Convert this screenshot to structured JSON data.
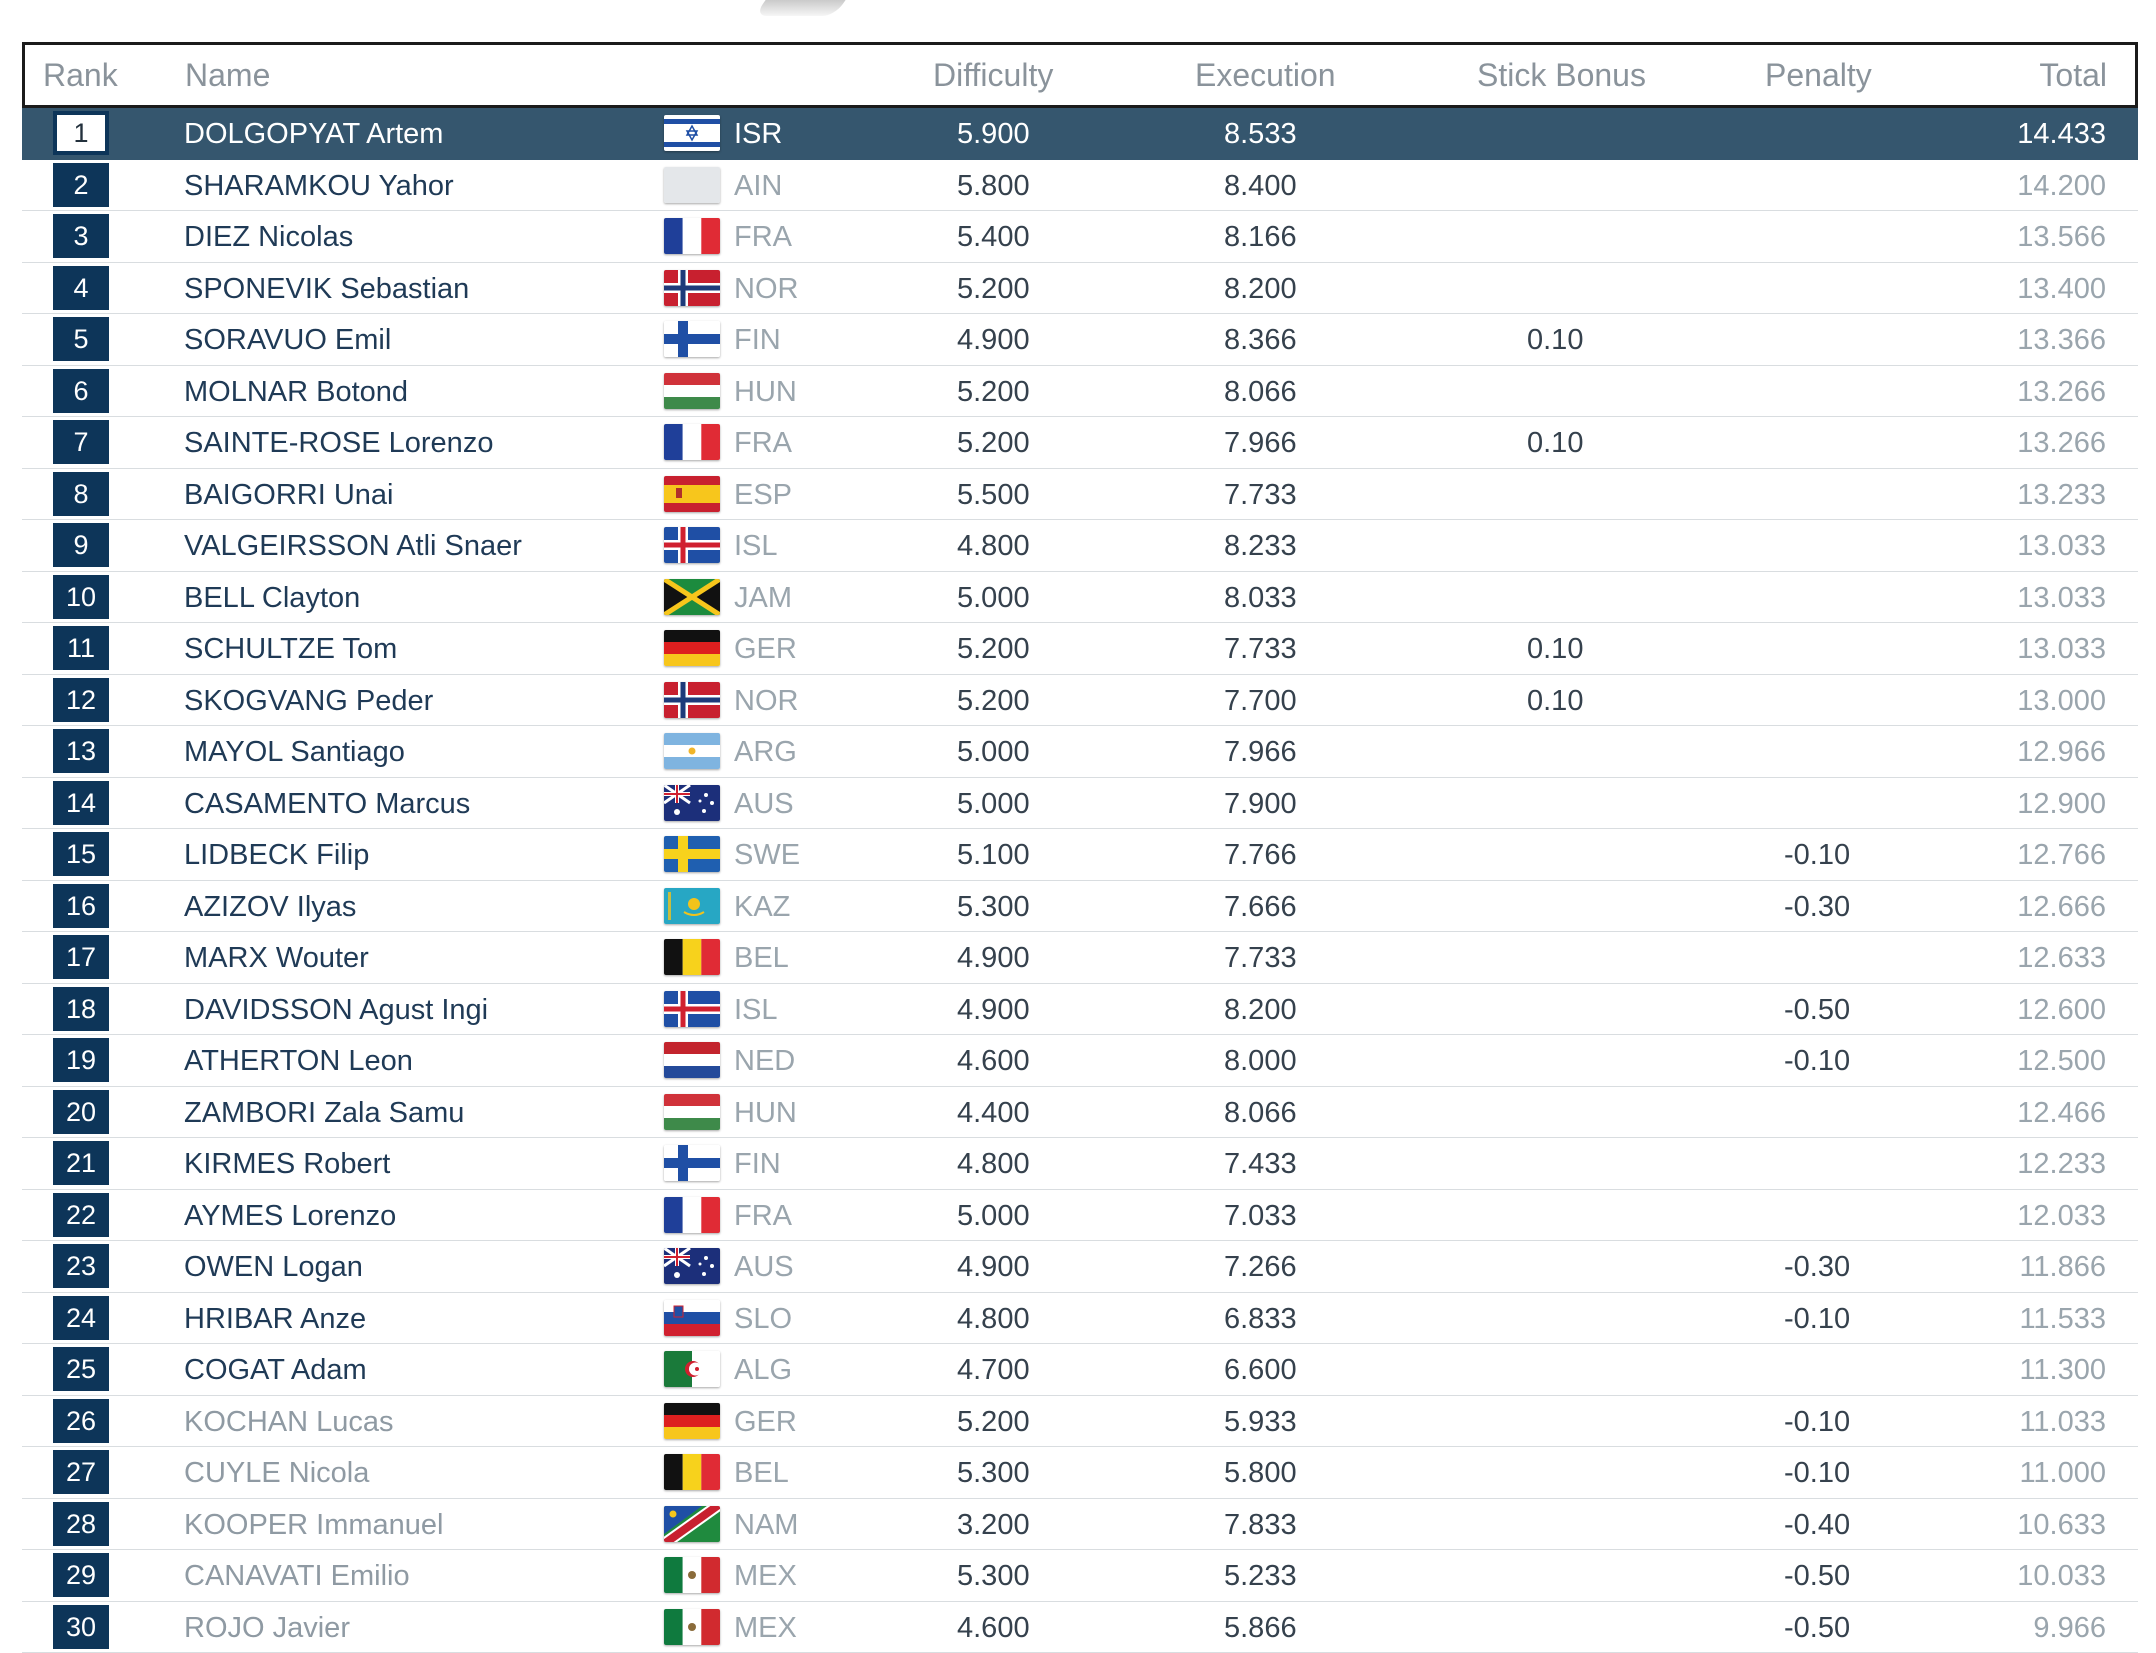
{
  "columns": {
    "rank": "Rank",
    "name": "Name",
    "difficulty": "Difficulty",
    "execution": "Execution",
    "stick_bonus": "Stick Bonus",
    "penalty": "Penalty",
    "total": "Total"
  },
  "colors": {
    "highlight_row": "#35566e",
    "rank_box": "#0d3559",
    "name_text": "#1f3a56",
    "muted_text": "#9aa5ad"
  },
  "rows": [
    {
      "rank": "1",
      "name": "DOLGOPYAT Artem",
      "country": "ISR",
      "difficulty": "5.900",
      "execution": "8.533",
      "stick": "",
      "penalty": "",
      "total": "14.433",
      "dim": false
    },
    {
      "rank": "2",
      "name": "SHARAMKOU Yahor",
      "country": "AIN",
      "difficulty": "5.800",
      "execution": "8.400",
      "stick": "",
      "penalty": "",
      "total": "14.200",
      "dim": false
    },
    {
      "rank": "3",
      "name": "DIEZ Nicolas",
      "country": "FRA",
      "difficulty": "5.400",
      "execution": "8.166",
      "stick": "",
      "penalty": "",
      "total": "13.566",
      "dim": false
    },
    {
      "rank": "4",
      "name": "SPONEVIK Sebastian",
      "country": "NOR",
      "difficulty": "5.200",
      "execution": "8.200",
      "stick": "",
      "penalty": "",
      "total": "13.400",
      "dim": false
    },
    {
      "rank": "5",
      "name": "SORAVUO Emil",
      "country": "FIN",
      "difficulty": "4.900",
      "execution": "8.366",
      "stick": "0.10",
      "penalty": "",
      "total": "13.366",
      "dim": false
    },
    {
      "rank": "6",
      "name": "MOLNAR Botond",
      "country": "HUN",
      "difficulty": "5.200",
      "execution": "8.066",
      "stick": "",
      "penalty": "",
      "total": "13.266",
      "dim": false
    },
    {
      "rank": "7",
      "name": "SAINTE-ROSE Lorenzo",
      "country": "FRA",
      "difficulty": "5.200",
      "execution": "7.966",
      "stick": "0.10",
      "penalty": "",
      "total": "13.266",
      "dim": false
    },
    {
      "rank": "8",
      "name": "BAIGORRI Unai",
      "country": "ESP",
      "difficulty": "5.500",
      "execution": "7.733",
      "stick": "",
      "penalty": "",
      "total": "13.233",
      "dim": false
    },
    {
      "rank": "9",
      "name": "VALGEIRSSON Atli Snaer",
      "country": "ISL",
      "difficulty": "4.800",
      "execution": "8.233",
      "stick": "",
      "penalty": "",
      "total": "13.033",
      "dim": false
    },
    {
      "rank": "10",
      "name": "BELL Clayton",
      "country": "JAM",
      "difficulty": "5.000",
      "execution": "8.033",
      "stick": "",
      "penalty": "",
      "total": "13.033",
      "dim": false
    },
    {
      "rank": "11",
      "name": "SCHULTZE Tom",
      "country": "GER",
      "difficulty": "5.200",
      "execution": "7.733",
      "stick": "0.10",
      "penalty": "",
      "total": "13.033",
      "dim": false
    },
    {
      "rank": "12",
      "name": "SKOGVANG Peder",
      "country": "NOR",
      "difficulty": "5.200",
      "execution": "7.700",
      "stick": "0.10",
      "penalty": "",
      "total": "13.000",
      "dim": false
    },
    {
      "rank": "13",
      "name": "MAYOL Santiago",
      "country": "ARG",
      "difficulty": "5.000",
      "execution": "7.966",
      "stick": "",
      "penalty": "",
      "total": "12.966",
      "dim": false
    },
    {
      "rank": "14",
      "name": "CASAMENTO Marcus",
      "country": "AUS",
      "difficulty": "5.000",
      "execution": "7.900",
      "stick": "",
      "penalty": "",
      "total": "12.900",
      "dim": false
    },
    {
      "rank": "15",
      "name": "LIDBECK Filip",
      "country": "SWE",
      "difficulty": "5.100",
      "execution": "7.766",
      "stick": "",
      "penalty": "-0.10",
      "total": "12.766",
      "dim": false
    },
    {
      "rank": "16",
      "name": "AZIZOV Ilyas",
      "country": "KAZ",
      "difficulty": "5.300",
      "execution": "7.666",
      "stick": "",
      "penalty": "-0.30",
      "total": "12.666",
      "dim": false
    },
    {
      "rank": "17",
      "name": "MARX Wouter",
      "country": "BEL",
      "difficulty": "4.900",
      "execution": "7.733",
      "stick": "",
      "penalty": "",
      "total": "12.633",
      "dim": false
    },
    {
      "rank": "18",
      "name": "DAVIDSSON Agust Ingi",
      "country": "ISL",
      "difficulty": "4.900",
      "execution": "8.200",
      "stick": "",
      "penalty": "-0.50",
      "total": "12.600",
      "dim": false
    },
    {
      "rank": "19",
      "name": "ATHERTON Leon",
      "country": "NED",
      "difficulty": "4.600",
      "execution": "8.000",
      "stick": "",
      "penalty": "-0.10",
      "total": "12.500",
      "dim": false
    },
    {
      "rank": "20",
      "name": "ZAMBORI Zala Samu",
      "country": "HUN",
      "difficulty": "4.400",
      "execution": "8.066",
      "stick": "",
      "penalty": "",
      "total": "12.466",
      "dim": false
    },
    {
      "rank": "21",
      "name": "KIRMES Robert",
      "country": "FIN",
      "difficulty": "4.800",
      "execution": "7.433",
      "stick": "",
      "penalty": "",
      "total": "12.233",
      "dim": false
    },
    {
      "rank": "22",
      "name": "AYMES Lorenzo",
      "country": "FRA",
      "difficulty": "5.000",
      "execution": "7.033",
      "stick": "",
      "penalty": "",
      "total": "12.033",
      "dim": false
    },
    {
      "rank": "23",
      "name": "OWEN Logan",
      "country": "AUS",
      "difficulty": "4.900",
      "execution": "7.266",
      "stick": "",
      "penalty": "-0.30",
      "total": "11.866",
      "dim": false
    },
    {
      "rank": "24",
      "name": "HRIBAR Anze",
      "country": "SLO",
      "difficulty": "4.800",
      "execution": "6.833",
      "stick": "",
      "penalty": "-0.10",
      "total": "11.533",
      "dim": false
    },
    {
      "rank": "25",
      "name": "COGAT Adam",
      "country": "ALG",
      "difficulty": "4.700",
      "execution": "6.600",
      "stick": "",
      "penalty": "",
      "total": "11.300",
      "dim": false
    },
    {
      "rank": "26",
      "name": "KOCHAN Lucas",
      "country": "GER",
      "difficulty": "5.200",
      "execution": "5.933",
      "stick": "",
      "penalty": "-0.10",
      "total": "11.033",
      "dim": true
    },
    {
      "rank": "27",
      "name": "CUYLE Nicola",
      "country": "BEL",
      "difficulty": "5.300",
      "execution": "5.800",
      "stick": "",
      "penalty": "-0.10",
      "total": "11.000",
      "dim": true
    },
    {
      "rank": "28",
      "name": "KOOPER Immanuel",
      "country": "NAM",
      "difficulty": "3.200",
      "execution": "7.833",
      "stick": "",
      "penalty": "-0.40",
      "total": "10.633",
      "dim": true
    },
    {
      "rank": "29",
      "name": "CANAVATI Emilio",
      "country": "MEX",
      "difficulty": "5.300",
      "execution": "5.233",
      "stick": "",
      "penalty": "-0.50",
      "total": "10.033",
      "dim": true
    },
    {
      "rank": "30",
      "name": "ROJO Javier",
      "country": "MEX",
      "difficulty": "4.600",
      "execution": "5.866",
      "stick": "",
      "penalty": "-0.50",
      "total": "9.966",
      "dim": true
    }
  ]
}
